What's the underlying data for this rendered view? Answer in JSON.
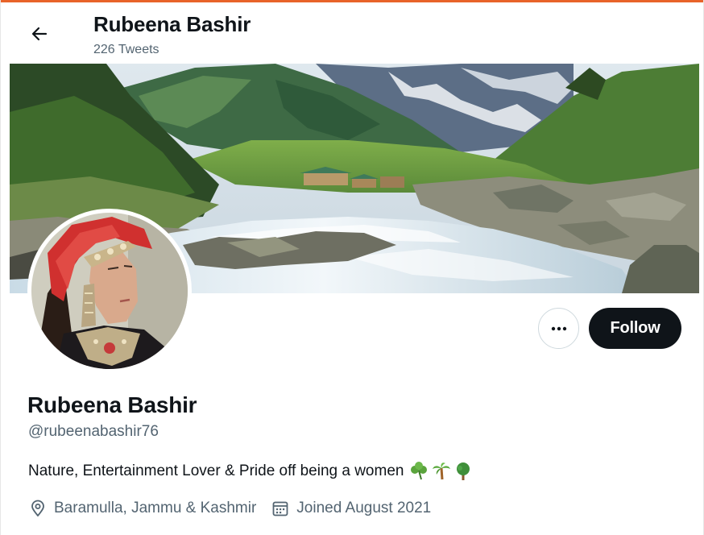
{
  "header": {
    "title": "Rubeena Bashir",
    "tweet_count": "226 Tweets"
  },
  "profile": {
    "name": "Rubeena Bashir",
    "handle": "@rubeenabashir76",
    "bio": "Nature, Entertainment Lover & Pride off being a women",
    "bio_emojis": [
      "shamrock-icon",
      "palm-tree-icon",
      "tree-icon"
    ],
    "location": "Baramulla, Jammu & Kashmir",
    "joined": "Joined August 2021"
  },
  "actions": {
    "more_icon": "more-icon",
    "follow_label": "Follow"
  },
  "colors": {
    "accent_line": "#e8632a",
    "text_primary": "#0f1419",
    "text_secondary": "#536471",
    "follow_bg": "#0f1419",
    "border": "#cfd9de"
  }
}
